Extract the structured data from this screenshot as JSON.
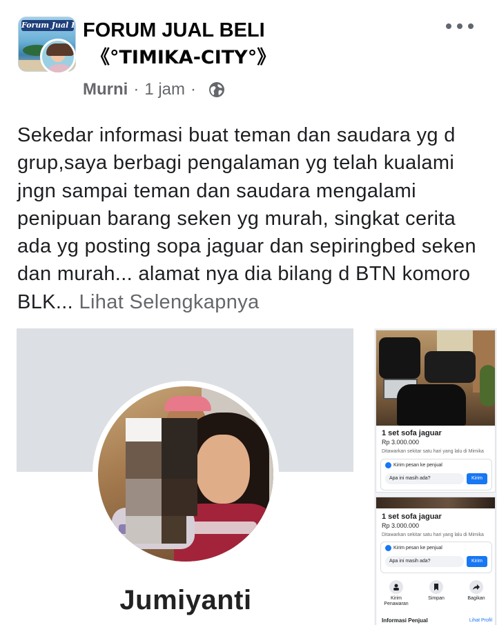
{
  "post": {
    "group_name_line1": "FORUM JUAL BELI",
    "group_name_line2": "《°TIMIKA-CITY°》",
    "group_avatar_text": "Forum Jual Beli",
    "author": "Murni",
    "separator": "·",
    "time": "1 jam",
    "privacy_icon": "globe-icon",
    "more_icon": "more-options-icon",
    "text": "Sekedar informasi buat teman dan saudara yg d grup,saya berbagi pengalaman yg telah kualami jngn sampai teman dan saudara mengalami penipuan barang seken yg murah, singkat cerita ada yg posting sopa jaguar dan sepiringbed seken dan murah... alamat nya dia bilang d BTN komoro BLK...",
    "see_more": "Lihat Selengkapnya"
  },
  "profile_image": {
    "name": "Jumiyanti"
  },
  "listings": [
    {
      "title": "1 set sofa jaguar",
      "price": "Rp 3.000.000",
      "note": "Ditawarkan sekitar satu hari yang lalu di Mimika",
      "message_label": "Kirim pesan ke penjual",
      "message_input": "Apa ini masih ada?",
      "send_label": "Kirim"
    },
    {
      "title": "1 set sofa jaguar",
      "price": "Rp 3.000.000",
      "note": "Ditawarkan sekitar satu hari yang lalu di Mimika",
      "message_label": "Kirim pesan ke penjual",
      "message_input": "Apa ini masih ada?",
      "send_label": "Kirim",
      "actions": [
        {
          "label": "Kirim Penawaran",
          "icon": "offer-icon"
        },
        {
          "label": "Simpan",
          "icon": "bookmark-icon"
        },
        {
          "label": "Bagikan",
          "icon": "share-icon"
        }
      ],
      "info_title": "Informasi Penjual",
      "info_link": "Lihat Profil"
    }
  ],
  "colors": {
    "accent": "#1877f2",
    "meta_text": "#65676b",
    "cover_gray": "#dcdfe4"
  }
}
